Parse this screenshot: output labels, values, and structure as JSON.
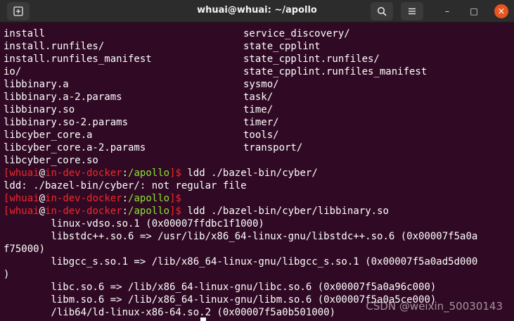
{
  "window": {
    "title": "whuai@whuai: ~/apollo",
    "new_tab_icon": "new-tab-icon",
    "search_icon": "search-icon",
    "menu_icon": "hamburger-menu-icon",
    "minimize_glyph": "–",
    "maximize_glyph": "□",
    "close_glyph": "×"
  },
  "listing": {
    "col1": [
      "install",
      "install.runfiles/",
      "install.runfiles_manifest",
      "io/",
      "libbinary.a",
      "libbinary.a-2.params",
      "libbinary.so",
      "libbinary.so-2.params",
      "libcyber_core.a",
      "libcyber_core.a-2.params",
      "libcyber_core.so"
    ],
    "col2": [
      "service_discovery/",
      "state_cpplint",
      "state_cpplint.runfiles/",
      "state_cpplint.runfiles_manifest",
      "sysmo/",
      "task/",
      "time/",
      "timer/",
      "tools/",
      "transport/"
    ]
  },
  "prompt": {
    "open": "[",
    "user": "whuai",
    "at": "@",
    "host": "in-dev-docker",
    "colon": ":",
    "path": "/apollo",
    "close": "]$"
  },
  "commands": {
    "cmd1": " ldd ./bazel-bin/cyber/",
    "err1": "ldd: ./bazel-bin/cyber/: not regular file",
    "cmd2": "",
    "cmd3": " ldd ./bazel-bin/cyber/libbinary.so"
  },
  "output": [
    "        linux-vdso.so.1 (0x00007ffdbc1f1000)",
    "        libstdc++.so.6 => /usr/lib/x86_64-linux-gnu/libstdc++.so.6 (0x00007f5a0a",
    "f75000)",
    "        libgcc_s.so.1 => /lib/x86_64-linux-gnu/libgcc_s.so.1 (0x00007f5a0ad5d000",
    ")",
    "        libc.so.6 => /lib/x86_64-linux-gnu/libc.so.6 (0x00007f5a0a96c000)",
    "        libm.so.6 => /lib/x86_64-linux-gnu/libm.so.6 (0x00007f5a0a5ce000)",
    "        /lib64/ld-linux-x86-64.so.2 (0x00007f5a0b501000)"
  ],
  "watermark": "CSDN @weixin_50030143"
}
